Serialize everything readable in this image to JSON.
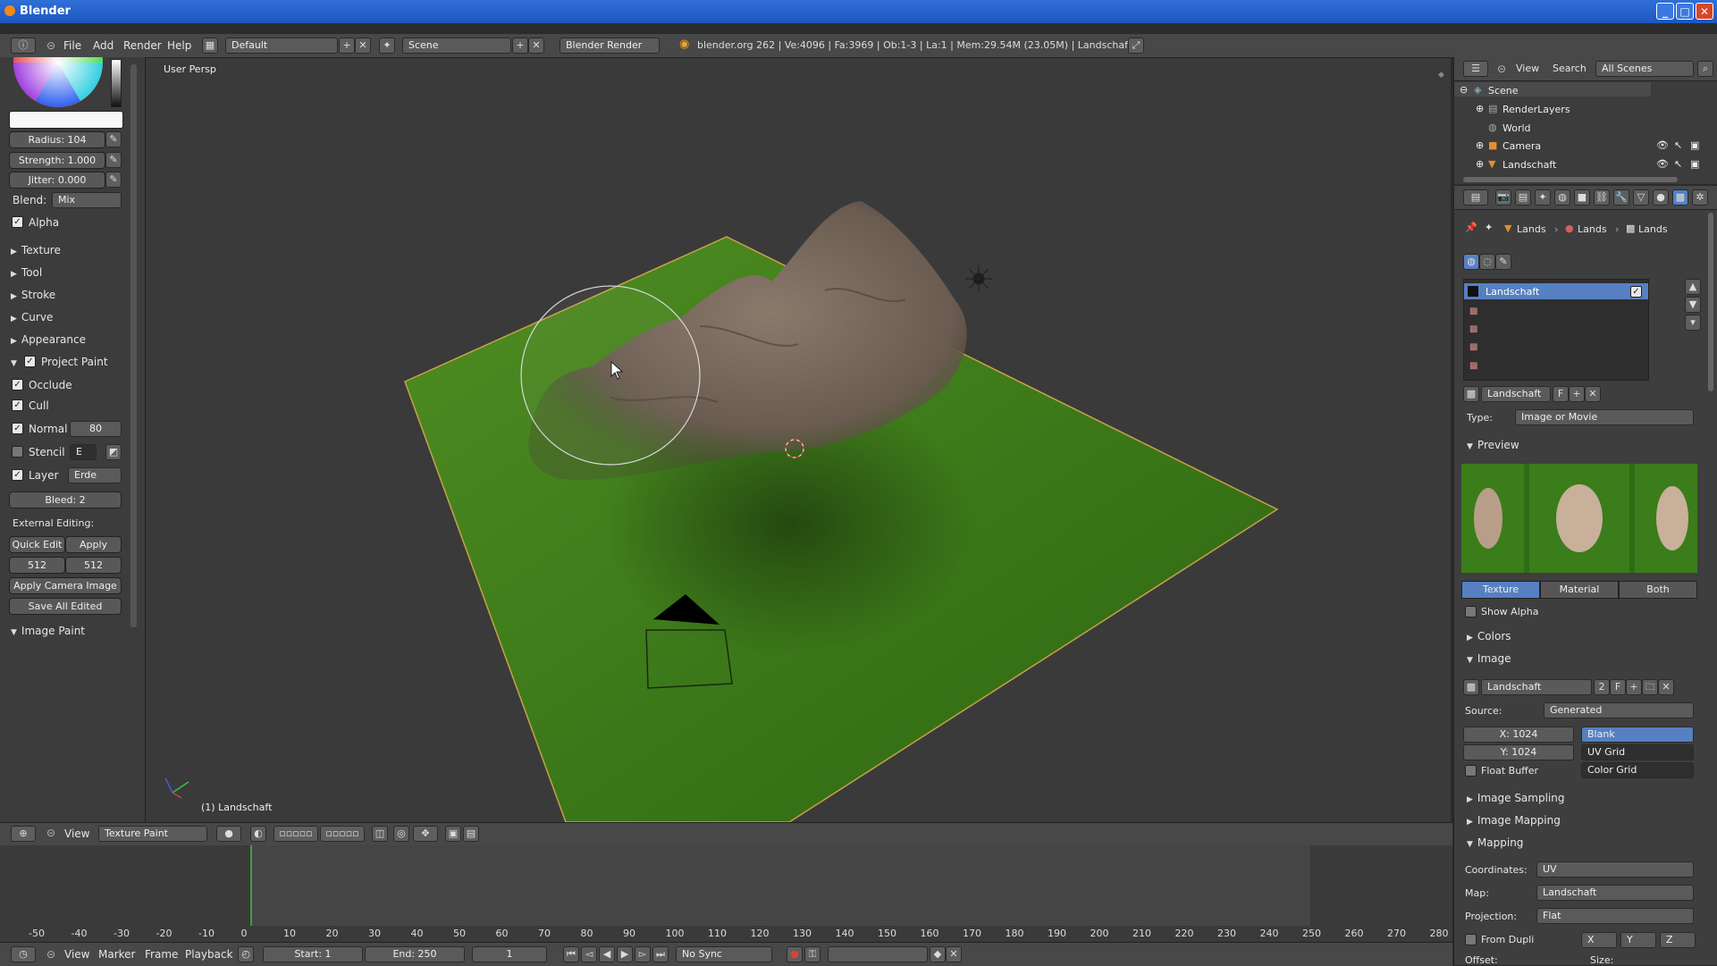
{
  "window": {
    "title": "Blender",
    "min": "_",
    "max": "□",
    "close": "✕"
  },
  "info_header": {
    "menus": [
      "File",
      "Add",
      "Render",
      "Help"
    ],
    "screen_layout": "Default",
    "scene": "Scene",
    "render_engine": "Blender Render",
    "stats": "blender.org 262 | Ve:4096 | Fa:3969 | Ob:1-3 | La:1 | Mem:29.54M (23.05M) | Landschaft"
  },
  "left_panel": {
    "radius": "Radius: 104",
    "strength": "Strength: 1.000",
    "jitter": "Jitter: 0.000",
    "blend_label": "Blend:",
    "blend_value": "Mix",
    "alpha": "Alpha",
    "sections": [
      "Texture",
      "Tool",
      "Stroke",
      "Curve",
      "Appearance"
    ],
    "project_paint": "Project Paint",
    "occlude": "Occlude",
    "cull": "Cull",
    "normal": "Normal",
    "normal_value": "80",
    "stencil": "Stencil",
    "stencil_value": "E",
    "layer": "Layer",
    "layer_value": "Erde",
    "bleed": "Bleed: 2",
    "external_editing": "External Editing:",
    "quick_edit": "Quick Edit",
    "apply": "Apply",
    "size_x": "512",
    "size_y": "512",
    "apply_camera_image": "Apply Camera Image",
    "save_all_edited": "Save All Edited",
    "image_paint": "Image Paint"
  },
  "viewport": {
    "view_name": "User Persp",
    "object_name": "(1) Landschaft"
  },
  "view3d_header": {
    "view": "View",
    "mode": "Texture Paint"
  },
  "timeline": {
    "ticks": [
      "-50",
      "-40",
      "-30",
      "-20",
      "-10",
      "0",
      "10",
      "20",
      "30",
      "40",
      "50",
      "60",
      "70",
      "80",
      "90",
      "100",
      "110",
      "120",
      "130",
      "140",
      "150",
      "160",
      "170",
      "180",
      "190",
      "200",
      "210",
      "220",
      "230",
      "240",
      "250",
      "260",
      "270",
      "280"
    ],
    "menus": [
      "View",
      "Marker",
      "Frame",
      "Playback"
    ],
    "start": "Start: 1",
    "end": "End: 250",
    "current": "1",
    "sync": "No Sync"
  },
  "outliner": {
    "view": "View",
    "search": "Search",
    "filter": "All Scenes",
    "items": [
      "Scene",
      "RenderLayers",
      "World",
      "Camera",
      "Landschaft"
    ]
  },
  "properties": {
    "breadcrumb": [
      "Lands",
      "Lands",
      "Lands"
    ],
    "slot_name": "Landschaft",
    "texture_name": "Landschaft",
    "f_label": "F",
    "type_label": "Type:",
    "type_value": "Image or Movie",
    "preview": "Preview",
    "tab_texture": "Texture",
    "tab_material": "Material",
    "tab_both": "Both",
    "show_alpha": "Show Alpha",
    "colors": "Colors",
    "image": "Image",
    "image_name": "Landschaft",
    "image_users": "2",
    "source_label": "Source:",
    "source_value": "Generated",
    "x": "X: 1024",
    "y": "Y: 1024",
    "gen_blank": "Blank",
    "gen_uv_grid": "UV Grid",
    "gen_color_grid": "Color Grid",
    "float_buffer": "Float Buffer",
    "image_sampling": "Image Sampling",
    "image_mapping": "Image Mapping",
    "mapping": "Mapping",
    "coordinates_label": "Coordinates:",
    "coordinates_value": "UV",
    "map_label": "Map:",
    "map_value": "Landschaft",
    "projection_label": "Projection:",
    "projection_value": "Flat",
    "from_dupli": "From Dupli",
    "axis_x": "X",
    "axis_y": "Y",
    "axis_z": "Z",
    "offset": "Offset:",
    "size": "Size:"
  },
  "colors": {
    "accent": "#5680c2",
    "grass": "#3f7d1e",
    "rock": "#6e5e52",
    "title_blue": "#1d57c0"
  }
}
